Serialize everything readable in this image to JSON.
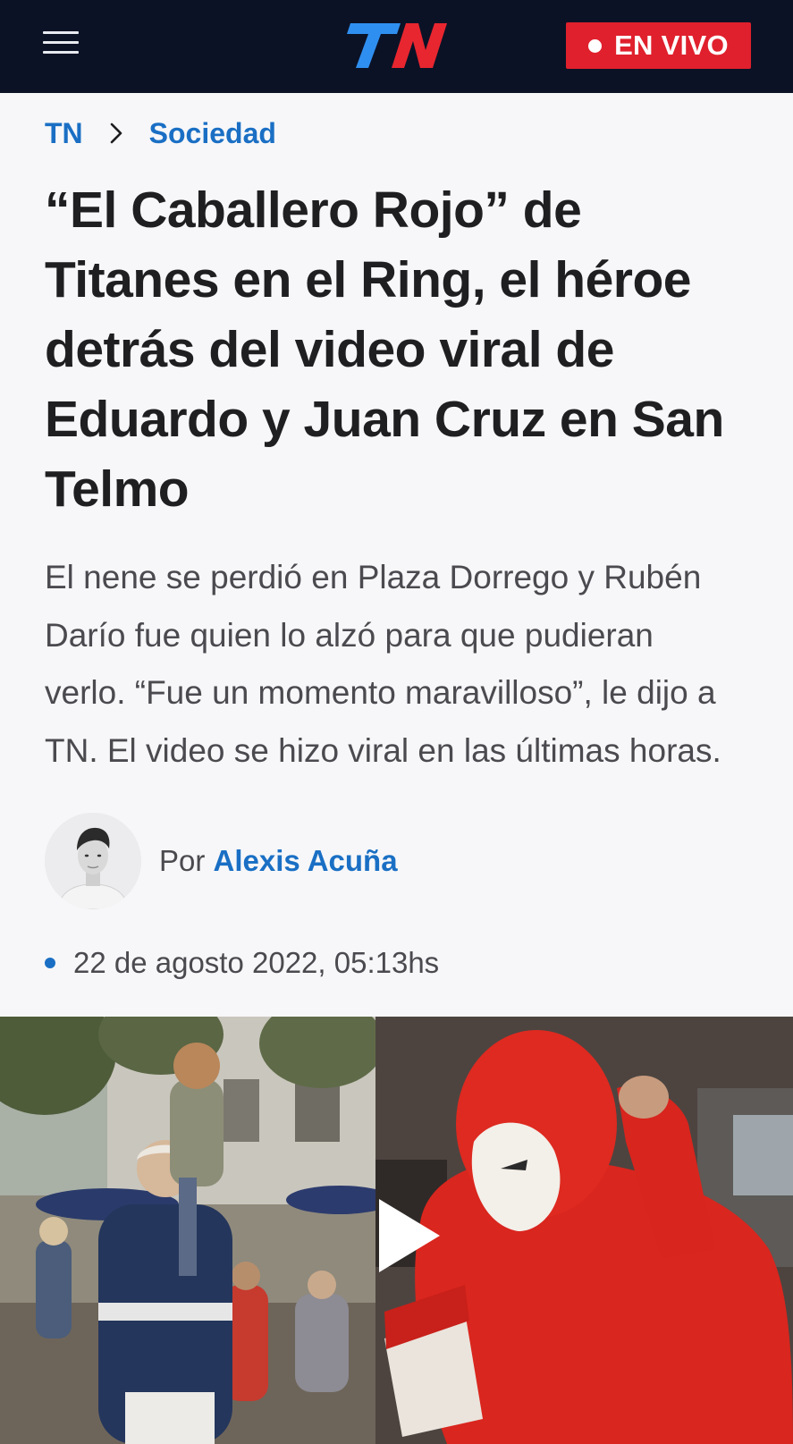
{
  "header": {
    "menu_icon": "hamburger-menu-icon",
    "logo_text": "TN",
    "live_label": "EN VIVO",
    "brand_color": "#0b1226",
    "live_color": "#e0202d"
  },
  "breadcrumb": {
    "home": "TN",
    "separator_icon": "chevron-right-icon",
    "section": "Sociedad",
    "link_color": "#1a6fc4"
  },
  "article": {
    "headline_lines": [
      "“El Caballero Rojo” de",
      "Titanes en el Ring, el héroe",
      "detrás del video viral de",
      "Eduardo y Juan Cruz en San",
      "Telmo"
    ],
    "summary_lines": [
      "El nene se perdió en Plaza Dorrego y Rubén",
      "Darío fue quien lo alzó para que pudieran",
      "verlo. “Fue un momento maravilloso”, le dijo a",
      "TN. El video se hizo viral en las últimas horas."
    ],
    "byline_prefix": "Por",
    "author": "Alexis Acuña",
    "date": "22 de agosto 2022, 05:13hs"
  },
  "media": {
    "play_icon": "play-icon"
  }
}
